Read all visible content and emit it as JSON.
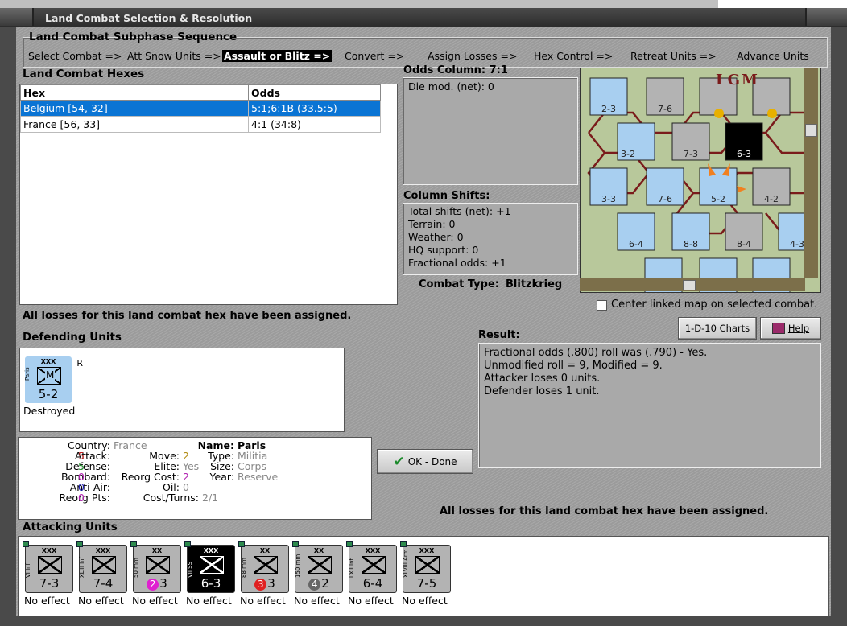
{
  "window": {
    "title": "Land Combat Selection & Resolution"
  },
  "sequence": {
    "title": "Land Combat Subphase Sequence",
    "steps": [
      "Select Combat =>",
      "Att Snow Units =>",
      "Assault or Blitz =>",
      "Convert =>",
      "Assign Losses =>",
      "Hex Control =>",
      "Retreat Units =>",
      "Advance Units"
    ],
    "active_index": 2
  },
  "hexes": {
    "title": "Land Combat Hexes",
    "columns": [
      "Hex",
      "Odds"
    ],
    "rows": [
      {
        "hex": "Belgium [54, 32]",
        "odds": "5:1;6:1B (33.5:5)",
        "selected": true
      },
      {
        "hex": "France [56, 33]",
        "odds": "4:1 (34:8)",
        "selected": false
      }
    ]
  },
  "odds": {
    "title": "Odds Column: 7:1",
    "die_mod": "Die mod. (net): 0"
  },
  "shifts": {
    "title": "Column Shifts:",
    "lines": [
      "Total shifts (net): +1",
      "Terrain: 0",
      "Weather: 0",
      "HQ support: 0",
      "Fractional odds: +1"
    ]
  },
  "combat_type": {
    "label": "Combat Type:",
    "value": "Blitzkrieg"
  },
  "center_map_label": "Center linked map on selected combat.",
  "losses_msg": "All losses for this land combat hex have been assigned.",
  "buttons": {
    "charts": "1-D-10 Charts",
    "help": "Help",
    "ok": "OK - Done"
  },
  "result": {
    "title": "Result:",
    "lines": [
      "Fractional odds (.800) roll was (.790)  - Yes.",
      "Unmodified roll = 9, Modified = 9.",
      "Attacker loses 0 units.",
      "Defender loses 1 unit."
    ]
  },
  "defending": {
    "title": "Defending Units",
    "unit": {
      "size": "XXX",
      "name": "Paris",
      "type_letter": "M",
      "values": "5-2",
      "corner": "R"
    },
    "status": "Destroyed"
  },
  "info": {
    "country_k": "Country:",
    "country_v": "France",
    "attack_k": "Attack:",
    "attack_v": "5",
    "defense_k": "Defense:",
    "defense_v": "5",
    "bombard_k": "Bombard:",
    "bombard_v": "0",
    "antiair_k": "Anti-Air:",
    "antiair_v": "0",
    "reorgpts_k": "Reorg Pts:",
    "reorgpts_v": "0",
    "move_k": "Move:",
    "move_v": "2",
    "elite_k": "Elite:",
    "elite_v": "Yes",
    "reorgcost_k": "Reorg Cost:",
    "reorgcost_v": "2",
    "oil_k": "Oil:",
    "oil_v": "0",
    "costturns_k": "Cost/Turns:",
    "costturns_v": "2/1",
    "name_k": "Name:",
    "name_v": "Paris",
    "type_k": "Type:",
    "type_v": "Militia",
    "size_k": "Size:",
    "size_v": "Corps",
    "year_k": "Year:",
    "year_v": "Reserve"
  },
  "attacking": {
    "title": "Attacking Units",
    "units": [
      {
        "size": "XXX",
        "name": "VI Inf",
        "values": "7-3",
        "status": "No effect",
        "dark": false,
        "badge": ""
      },
      {
        "size": "XXX",
        "name": "XLIII Inf",
        "values": "7-4",
        "status": "No effect",
        "dark": false,
        "badge": ""
      },
      {
        "size": "XX",
        "name": "50 mm",
        "values": "3",
        "status": "No effect",
        "dark": false,
        "badge": "2",
        "badge_color": "#e020d0"
      },
      {
        "size": "XXX",
        "name": "VII SS",
        "values": "6-3",
        "status": "No effect",
        "dark": true,
        "badge": ""
      },
      {
        "size": "XX",
        "name": "88 mm",
        "values": "3",
        "status": "No effect",
        "dark": false,
        "badge": "3",
        "badge_color": "#e02020"
      },
      {
        "size": "XX",
        "name": "150 mm",
        "values": "2",
        "status": "No effect",
        "dark": false,
        "badge": "4",
        "badge_color": "#666666"
      },
      {
        "size": "XXX",
        "name": "LXII Inf",
        "values": "6-4",
        "status": "No effect",
        "dark": false,
        "badge": ""
      },
      {
        "size": "XXX",
        "name": "XLVIII Arm",
        "values": "7-5",
        "status": "No effect",
        "dark": false,
        "badge": ""
      }
    ]
  },
  "colors": {
    "selection": "#0a74d4",
    "allied_counter": "#a8cff0",
    "axis_counter": "#b3b3b3"
  }
}
